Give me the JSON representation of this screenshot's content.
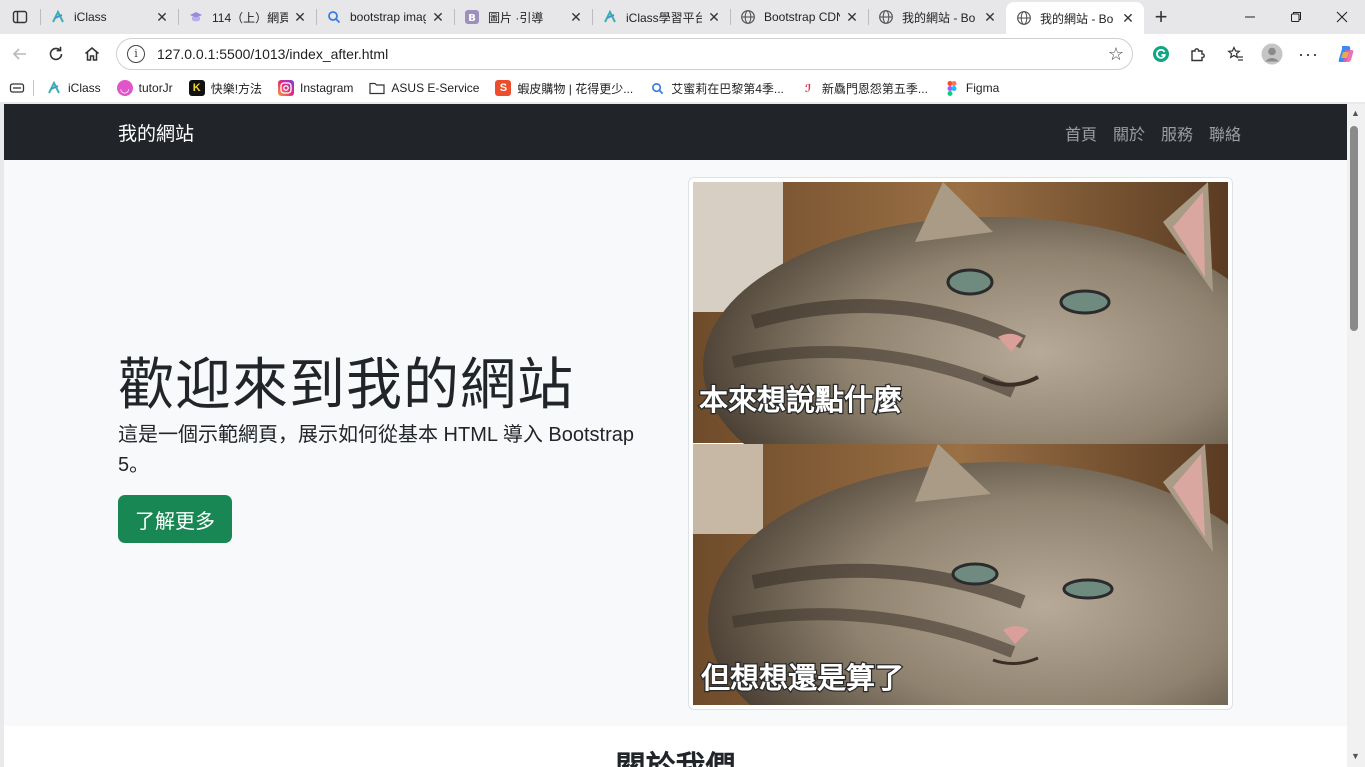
{
  "browser": {
    "tabs": [
      {
        "title": "iClass",
        "icon": "iclass-icon",
        "active": false
      },
      {
        "title": "114（上）網頁",
        "icon": "course-icon",
        "active": false
      },
      {
        "title": "bootstrap imag",
        "icon": "search-icon",
        "active": false
      },
      {
        "title": "圖片 ·引導",
        "icon": "bootstrap-icon",
        "active": false
      },
      {
        "title": "iClass學習平台",
        "icon": "iclass-icon",
        "active": false
      },
      {
        "title": "Bootstrap CDN",
        "icon": "globe-icon",
        "active": false
      },
      {
        "title": "我的網站 - Bo",
        "icon": "globe-icon",
        "active": false
      },
      {
        "title": "我的網站 - Bo",
        "icon": "globe-icon",
        "active": true
      }
    ],
    "url": "127.0.0.1:5500/1013/index_after.html",
    "bookmarks": [
      {
        "label": "iClass",
        "icon": "iclass-icon"
      },
      {
        "label": "tutorJr",
        "icon": "tutorjr-icon"
      },
      {
        "label": "快樂!方法",
        "icon": "k-logo-icon"
      },
      {
        "label": "Instagram",
        "icon": "instagram-icon"
      },
      {
        "label": "ASUS E-Service",
        "icon": "folder-icon"
      },
      {
        "label": "蝦皮購物 | 花得更少...",
        "icon": "shopee-icon"
      },
      {
        "label": "艾蜜莉在巴黎第4季...",
        "icon": "search-icon"
      },
      {
        "label": "新驫門恩怨第五季...",
        "icon": "netflix-icon"
      },
      {
        "label": "Figma",
        "icon": "figma-icon"
      }
    ]
  },
  "site": {
    "brand": "我的網站",
    "nav": [
      "首頁",
      "關於",
      "服務",
      "聯絡"
    ],
    "hero": {
      "title": "歡迎來到我的網站",
      "lead": "這是一個示範網頁，展示如何從基本 HTML 導入 Bootstrap 5。",
      "button": "了解更多"
    },
    "image": {
      "caption_top": "本來想說點什麼",
      "caption_bottom": "但想想還是算了"
    },
    "about_title": "關於我們"
  },
  "colors": {
    "navbar": "#212529",
    "button": "#198754",
    "page_bg": "#f8f9fa"
  }
}
